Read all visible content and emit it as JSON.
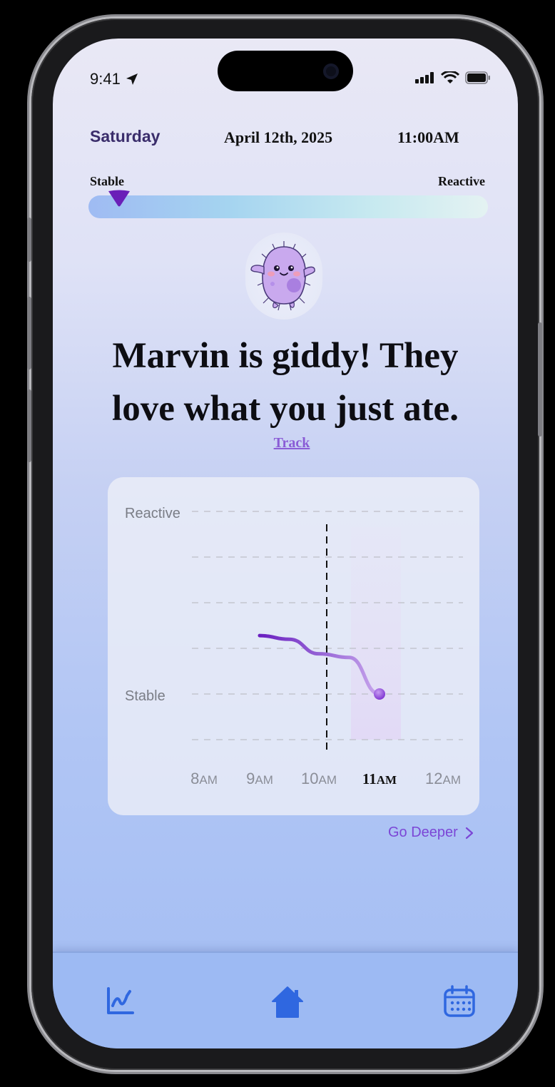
{
  "status_bar": {
    "time": "9:41"
  },
  "header": {
    "day": "Saturday",
    "date": "April 12th, 2025",
    "time": "11:00AM"
  },
  "scale": {
    "left_label": "Stable",
    "right_label": "Reactive",
    "level": 0.05
  },
  "mascot": {
    "icon": "microbe-mascot-icon"
  },
  "message": {
    "line1": "Marvin is giddy! They",
    "line2": "love what you just ate.",
    "link": "Track"
  },
  "chart_data": {
    "type": "line",
    "y_labels": [
      "Reactive",
      "Stable"
    ],
    "categories": [
      "8AM",
      "9AM",
      "10AM",
      "11AM",
      "12AM"
    ],
    "highlight_category": "11AM",
    "series": [
      {
        "values_note": "",
        "x": [
          9.0,
          9.5,
          10.0,
          10.5,
          11.0
        ],
        "y": [
          0.32,
          0.3,
          0.22,
          0.2,
          0.0
        ]
      }
    ],
    "colors": {
      "line_start": "#6a1fc0",
      "line_end": "#c8a6ec",
      "current_time_marker": "#111111"
    }
  },
  "go_deeper": {
    "label": "Go Deeper"
  },
  "tabbar": {
    "items": [
      {
        "icon": "trend-chart-icon"
      },
      {
        "icon": "home-icon"
      },
      {
        "icon": "calendar-icon"
      }
    ]
  },
  "colors": {
    "accent": "#7b46d6",
    "tab_icon": "#2f67e0",
    "marker": "#6a1fb8"
  }
}
